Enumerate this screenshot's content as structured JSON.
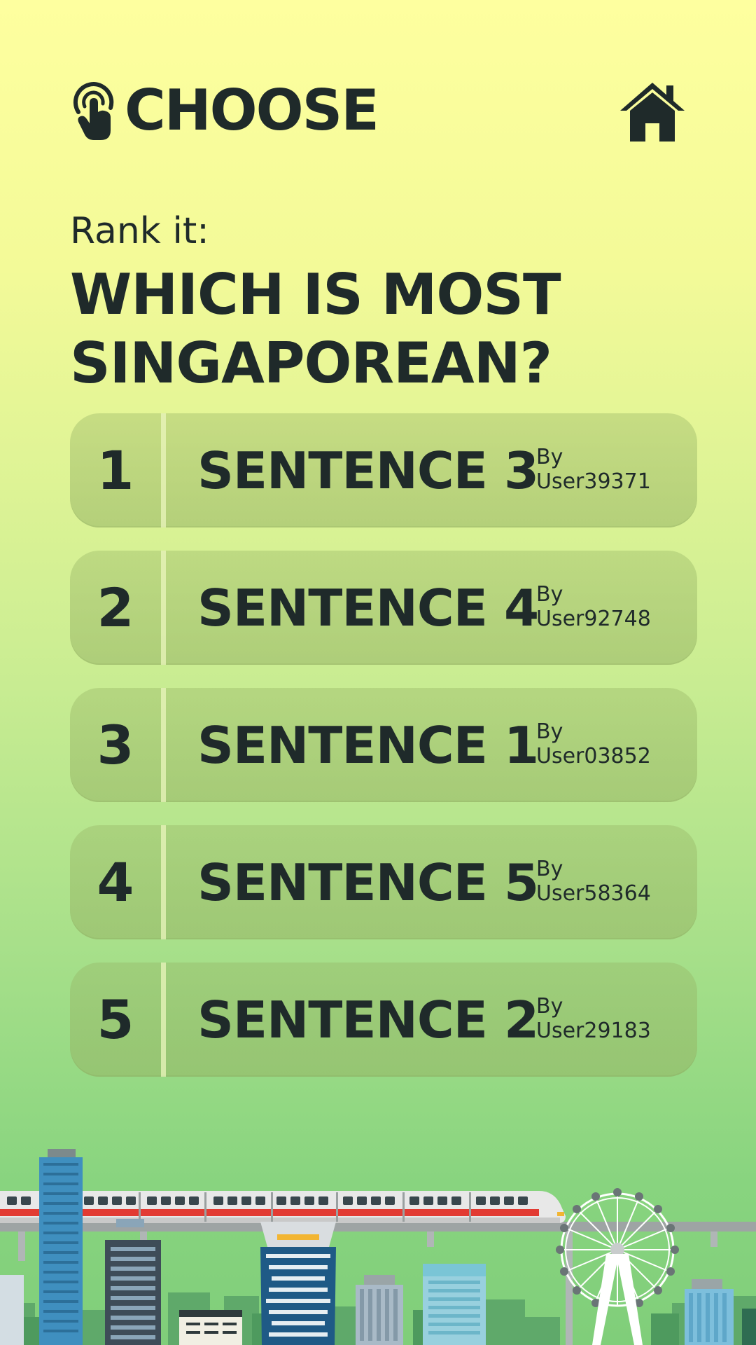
{
  "header": {
    "title": "CHOOSE",
    "logo_icon": "touch-hand-icon",
    "home_icon": "home-icon"
  },
  "prompt": {
    "subtitle": "Rank it:",
    "question_line1": "WHICH IS MOST",
    "question_line2": "SINGAPOREAN?"
  },
  "ranking": [
    {
      "rank": "1",
      "sentence": "SENTENCE 3",
      "by": "By",
      "user": "User39371"
    },
    {
      "rank": "2",
      "sentence": "SENTENCE 4",
      "by": "By",
      "user": "User92748"
    },
    {
      "rank": "3",
      "sentence": "SENTENCE 1",
      "by": "By",
      "user": "User03852"
    },
    {
      "rank": "4",
      "sentence": "SENTENCE 5",
      "by": "By",
      "user": "User58364"
    },
    {
      "rank": "5",
      "sentence": "SENTENCE 2",
      "by": "By",
      "user": "User29183"
    }
  ],
  "colors": {
    "background_top": "#feff9f",
    "background_bottom": "#80ce7a",
    "text": "#1f2a2a"
  }
}
